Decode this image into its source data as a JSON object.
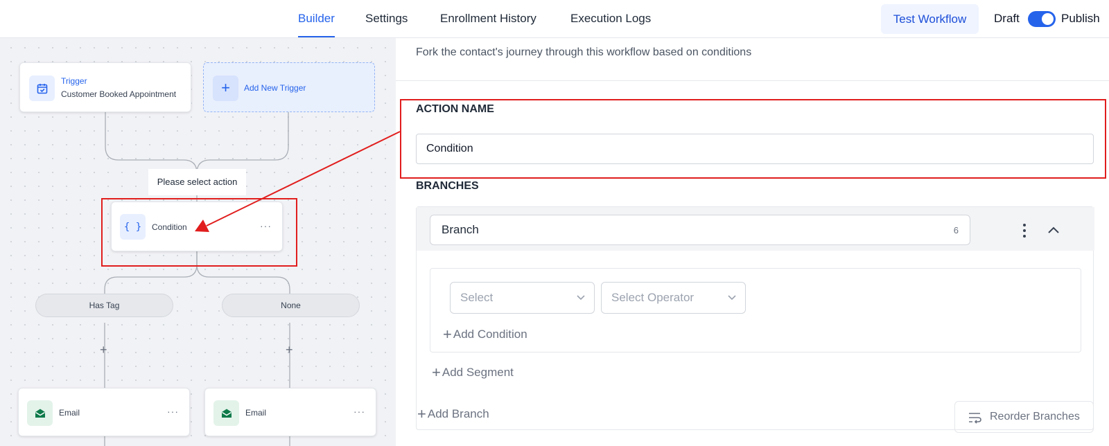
{
  "nav": {
    "tabs": [
      {
        "label": "Builder",
        "active": true
      },
      {
        "label": "Settings",
        "active": false
      },
      {
        "label": "Enrollment History",
        "active": false
      },
      {
        "label": "Execution Logs",
        "active": false
      }
    ],
    "test_button": "Test Workflow",
    "draft_label": "Draft",
    "publish_label": "Publish",
    "publish_on": true
  },
  "canvas": {
    "trigger": {
      "title": "Trigger",
      "subtitle": "Customer Booked Appointment",
      "icon": "calendar-check-icon"
    },
    "add_trigger": "Add New Trigger",
    "select_action": "Please select action",
    "condition": {
      "label": "Condition",
      "icon": "curly-braces-icon"
    },
    "branches": [
      {
        "label": "Has Tag",
        "action": "Email"
      },
      {
        "label": "None",
        "action": "Email"
      }
    ]
  },
  "panel": {
    "description": "Fork the contact's journey through this workflow based on conditions",
    "action_name_title": "ACTION NAME",
    "action_name_value": "Condition",
    "branches_title": "BRANCHES",
    "branch": {
      "name": "Branch",
      "char_count": "6"
    },
    "select_placeholder": "Select",
    "operator_placeholder": "Select Operator",
    "add_condition": "Add Condition",
    "add_segment": "Add Segment",
    "add_branch": "Add Branch",
    "reorder_branches": "Reorder Branches"
  },
  "colors": {
    "accent": "#2563eb",
    "annotation": "#e11d1d",
    "email_icon": "#0f7a4a"
  }
}
